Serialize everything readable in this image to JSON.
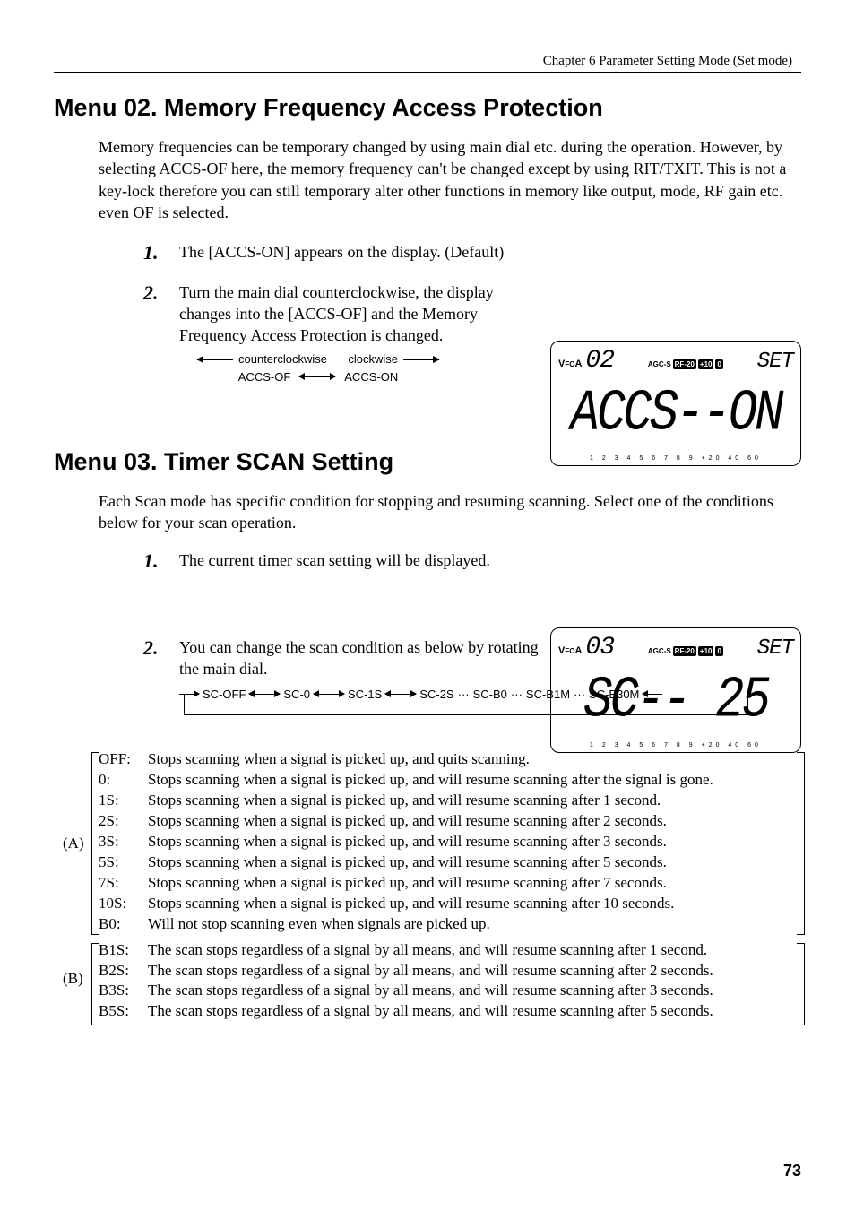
{
  "chapter": "Chapter 6   Parameter Setting Mode (Set mode)",
  "menu02": {
    "title": "Menu 02.  Memory Frequency Access Protection",
    "intro": "Memory frequencies can be temporary changed by using main dial etc. during the operation. However, by selecting ACCS-OF here, the memory frequency can't be changed except by using RIT/TXIT. This is not a key-lock therefore you can still temporary alter other functions in memory like output, mode, RF gain etc. even OF is selected.",
    "step1": "The [ACCS-ON] appears on the display. (Default)",
    "step2": "Turn the main dial counterclockwise, the display changes into the [ACCS-OF] and the Memory Frequency Access Protection is changed.",
    "arrow_ccw": "counterclockwise",
    "arrow_cw": "clockwise",
    "arrow_of": "ACCS-OF",
    "arrow_on": "ACCS-ON"
  },
  "menu03": {
    "title": "Menu 03.  Timer SCAN Setting",
    "intro": "Each Scan mode has specific condition for stopping and resuming scanning. Select one of the conditions below for your scan operation.",
    "step1": "The current timer scan setting will be displayed.",
    "step2": "You can change the scan condition as below by rotating the main dial.",
    "flow": {
      "f1": "SC-OFF",
      "f2": "SC-0",
      "f3": "SC-1S",
      "f4": "SC-2S",
      "f5": "SC-B0",
      "f6": "SC-B1M",
      "f7": "SC-B30M",
      "dots": "···"
    }
  },
  "lcd1": {
    "vfoa": "V",
    "vfoa2": "A",
    "fo": "FO",
    "num": "02",
    "agc": "AGC-",
    "agcS": "S",
    "rf": "RF-20",
    "p10": "+10",
    "p0": "0",
    "set": "SET",
    "main": "ACCS--ON",
    "scale": "1 2 3 4 5 6 7 8 9  +20  40  60"
  },
  "lcd2": {
    "num": "03",
    "main": "SC--  25",
    "scale": "1 2 3 4 5 6 7 8 9  +20  40  60"
  },
  "defs": {
    "groupA": "(A)",
    "groupB": "(B)",
    "rowsA": [
      {
        "k": "OFF:",
        "v": "Stops scanning when a signal is picked up, and quits scanning."
      },
      {
        "k": "0:",
        "v": "Stops scanning when a signal is picked up, and will resume scanning after the signal is gone."
      },
      {
        "k": "1S:",
        "v": "Stops scanning when a signal is picked up, and will resume scanning after 1 second."
      },
      {
        "k": "2S:",
        "v": "Stops scanning when a signal is picked up, and will resume scanning after 2 seconds."
      },
      {
        "k": "3S:",
        "v": "Stops scanning when a signal is picked up, and will resume scanning after 3 seconds."
      },
      {
        "k": "5S:",
        "v": "Stops scanning when a signal is picked up, and will resume scanning after 5 seconds."
      },
      {
        "k": "7S:",
        "v": "Stops scanning when a signal is picked up, and will resume scanning after 7 seconds."
      },
      {
        "k": "10S:",
        "v": "Stops scanning when a signal is picked up, and will resume scanning after 10 seconds."
      },
      {
        "k": "B0:",
        "v": "Will not stop scanning even when signals are picked up."
      }
    ],
    "rowsB": [
      {
        "k": "B1S:",
        "v": "The scan stops regardless of a signal by all means, and will resume scanning after 1 second."
      },
      {
        "k": "B2S:",
        "v": "The scan stops regardless of a signal by all means, and will resume scanning after 2 seconds."
      },
      {
        "k": "B3S:",
        "v": "The scan stops regardless of a signal by all means, and will resume scanning after 3 seconds."
      },
      {
        "k": "B5S:",
        "v": "The scan stops regardless of a signal by all means, and will resume scanning after 5 seconds."
      }
    ]
  },
  "page": "73"
}
